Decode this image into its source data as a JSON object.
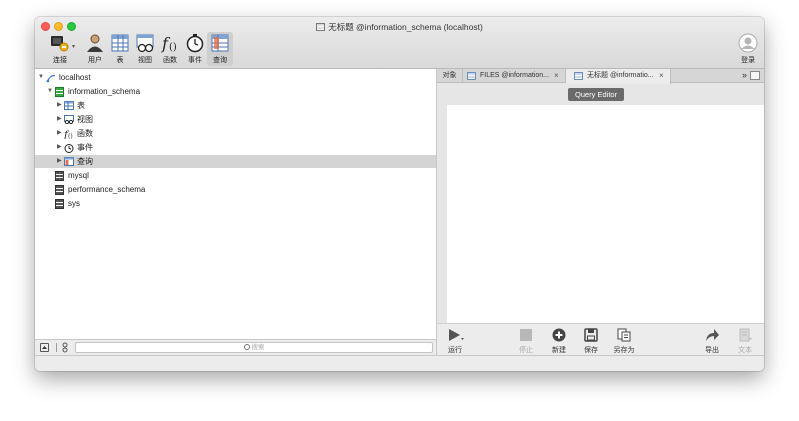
{
  "window": {
    "title": "无标题 @information_schema (localhost)"
  },
  "toolbar": {
    "items": [
      {
        "label": "连接",
        "icon": "connection-icon"
      },
      {
        "label": "用户",
        "icon": "user-icon"
      },
      {
        "label": "表",
        "icon": "table-icon"
      },
      {
        "label": "视图",
        "icon": "view-icon"
      },
      {
        "label": "函数",
        "icon": "function-icon"
      },
      {
        "label": "事件",
        "icon": "event-icon"
      },
      {
        "label": "查询",
        "icon": "query-icon"
      }
    ],
    "login_label": "登录"
  },
  "tree": {
    "connection": "localhost",
    "database": "information_schema",
    "children": [
      "表",
      "视图",
      "函数",
      "事件",
      "查询"
    ],
    "other_databases": [
      "mysql",
      "performance_schema",
      "sys"
    ]
  },
  "left_bottom": {
    "search_placeholder": "搜索"
  },
  "tabs": {
    "objects_label": "对象",
    "items": [
      {
        "label": "FILES @information..."
      },
      {
        "label": "无标题 @informatio..."
      }
    ]
  },
  "tooltip": "Query Editor",
  "editor_toolbar": {
    "run": "运行",
    "stop": "停止",
    "new": "新建",
    "save": "保存",
    "save_as": "另存为",
    "export": "导出",
    "text": "文本"
  },
  "colors": {
    "selection": "#d4d4d4",
    "tooltip_bg": "#6a6a6a",
    "db_icon_green": "#3aa646"
  }
}
